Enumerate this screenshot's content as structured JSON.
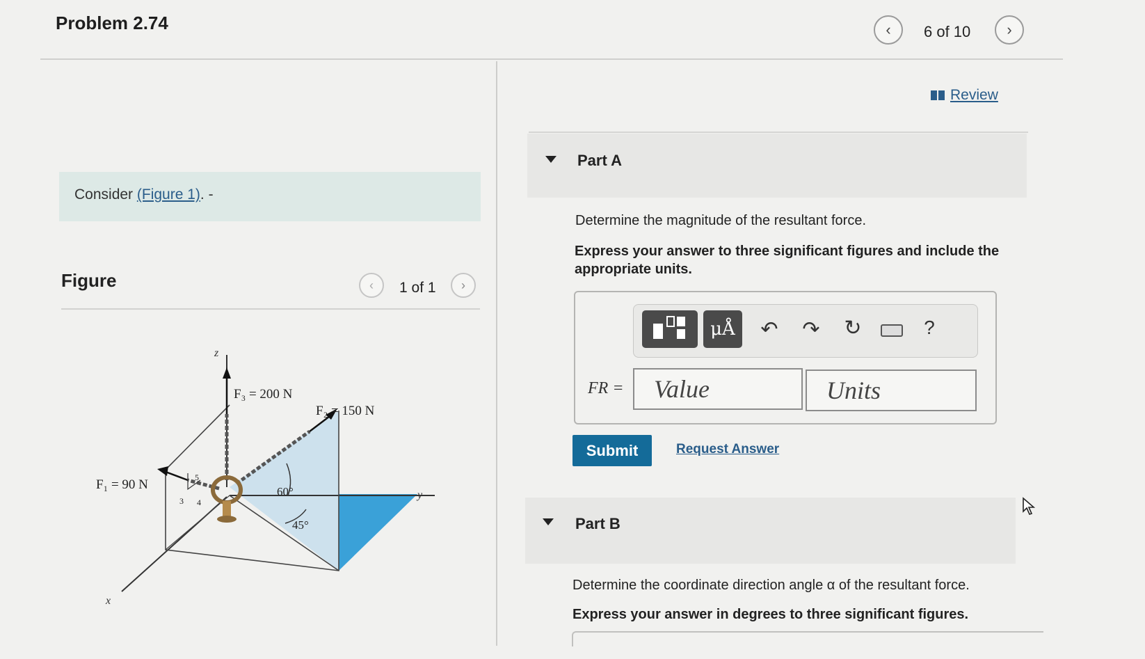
{
  "header": {
    "problem_title": "Problem 2.74",
    "nav": {
      "prev_icon": "chevron-left-icon",
      "position": "6 of 10",
      "next_icon": "chevron-right-icon"
    }
  },
  "left": {
    "consider_prefix": "Consider ",
    "consider_link": "(Figure 1)",
    "consider_suffix": ". -",
    "figure_heading": "Figure",
    "figure_nav": {
      "prev_icon": "chevron-left-icon",
      "position": "1 of 1",
      "next_icon": "chevron-right-icon"
    },
    "figure": {
      "axis_z": "z",
      "axis_x": "x",
      "axis_y": "y",
      "f1": "F₁ = 90 N",
      "f2": "F₂ = 150 N",
      "f3": "F₃ = 200 N",
      "angle_60": "60°",
      "angle_45": "45°",
      "slope_5": "5",
      "slope_3": "3",
      "slope_4": "4"
    }
  },
  "right": {
    "review_label": "Review",
    "part_a": {
      "label": "Part A",
      "question": "Determine the magnitude of the resultant force.",
      "instruction": "Express your answer to three significant figures and include the appropriate units.",
      "toolbar": {
        "templates_icon": "templates-icon",
        "units_button": "μÅ",
        "undo_icon": "undo-icon",
        "redo_icon": "redo-icon",
        "reset_icon": "reset-icon",
        "keyboard_icon": "keyboard-icon",
        "help": "?"
      },
      "answer_label": "FR =",
      "value_placeholder": "Value",
      "units_placeholder": "Units",
      "submit": "Submit",
      "request_answer": "Request Answer"
    },
    "part_b": {
      "label": "Part B",
      "question": "Determine the coordinate direction angle α of the resultant force.",
      "instruction": "Express your answer in degrees to three significant figures."
    }
  }
}
